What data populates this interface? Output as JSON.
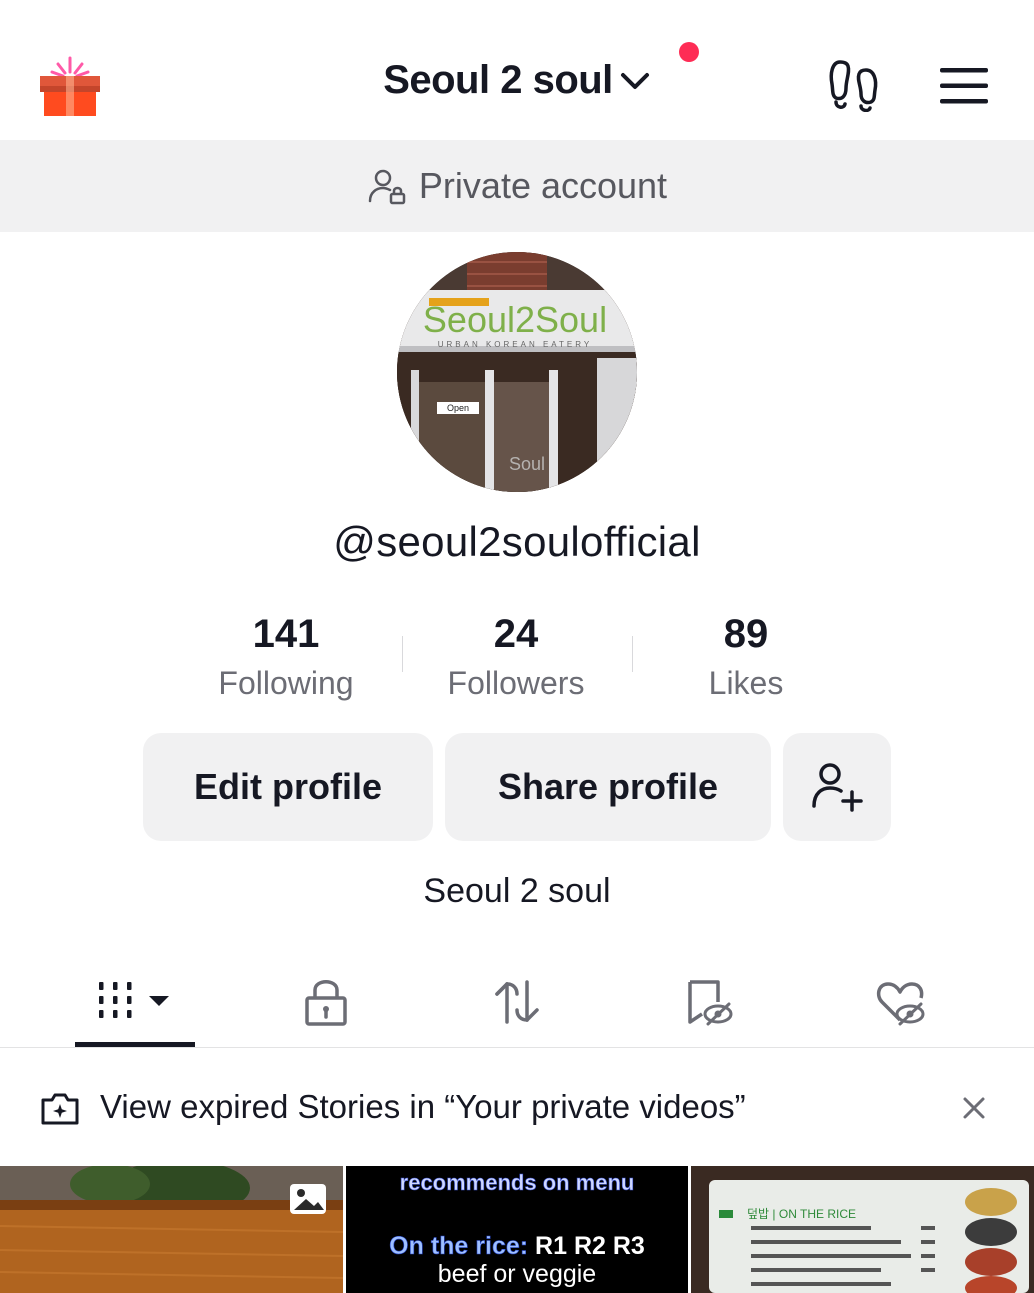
{
  "header": {
    "title": "Seoul 2 soul",
    "icons": [
      "gift-icon",
      "chevron-down-icon",
      "footprints-icon",
      "hamburger-menu-icon"
    ],
    "notification_color": "#fe2c55"
  },
  "privacy_banner": {
    "label": "Private account",
    "icon": "person-lock-icon"
  },
  "profile": {
    "avatar_lettering": "Seoul2Soul",
    "username": "@seoul2soulofficial",
    "bio": "Seoul 2 soul"
  },
  "stats": [
    {
      "value": "141",
      "label": "Following"
    },
    {
      "value": "24",
      "label": "Followers"
    },
    {
      "value": "89",
      "label": "Likes"
    }
  ],
  "buttons": {
    "edit": "Edit profile",
    "share": "Share profile",
    "add_friend_icon": "person-plus-icon"
  },
  "tabs": [
    {
      "icon": "videos-grid-icon",
      "active": true
    },
    {
      "icon": "lock-icon",
      "active": false
    },
    {
      "icon": "repost-icon",
      "active": false
    },
    {
      "icon": "favorites-hidden-icon",
      "active": false
    },
    {
      "icon": "liked-hidden-icon",
      "active": false
    }
  ],
  "notice": {
    "text": "View expired Stories in “Your private videos”",
    "icon": "camera-plus-icon",
    "close_icon": "close-icon"
  },
  "thumbnails": [
    {
      "kind": "photo",
      "badge_icon": "photo-icon"
    },
    {
      "kind": "text",
      "line1": "recommends on menu",
      "line2_highlight": "On the rice:",
      "line2_rest": " R1  R2  R3",
      "line3": "beef or veggie"
    },
    {
      "kind": "photo",
      "menu_heading": "덮밥 | ON THE RICE"
    }
  ]
}
